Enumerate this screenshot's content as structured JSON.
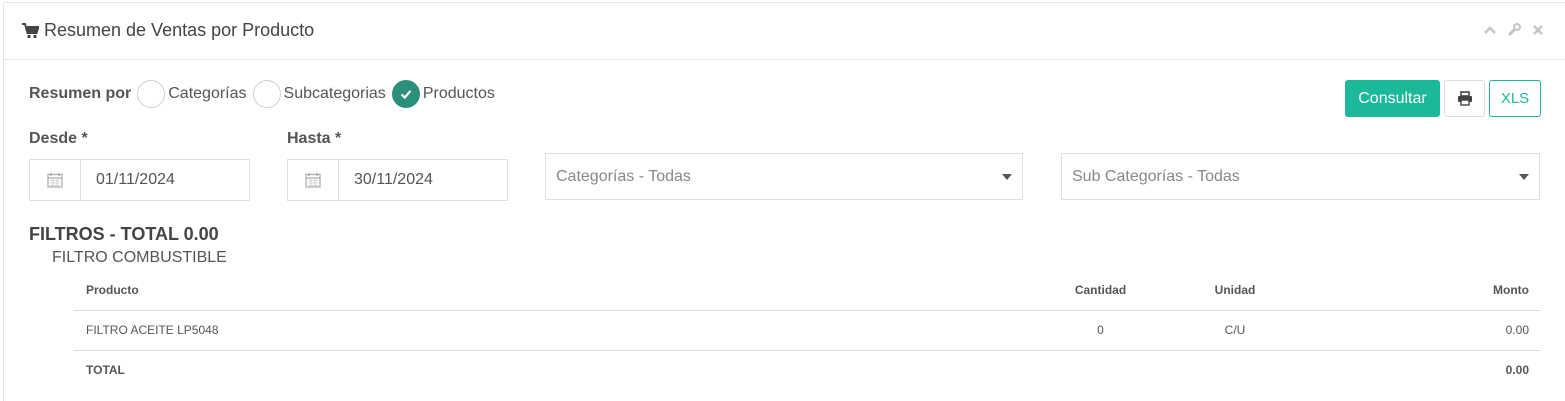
{
  "panel": {
    "title": "Resumen de Ventas por Producto",
    "icons": [
      "cart-icon",
      "chevron-up-icon",
      "wrench-icon",
      "close-icon"
    ]
  },
  "filters": {
    "resumen_por_label": "Resumen por",
    "options": [
      {
        "label": "Categorías",
        "checked": false
      },
      {
        "label": "Subcategorias",
        "checked": false
      },
      {
        "label": "Productos",
        "checked": true
      }
    ],
    "desde_label": "Desde *",
    "desde_value": "01/11/2024",
    "hasta_label": "Hasta *",
    "hasta_value": "30/11/2024",
    "categorias_selected": "Categorías - Todas",
    "subcategorias_selected": "Sub Categorías - Todas"
  },
  "actions": {
    "consultar_label": "Consultar",
    "xls_label": "XLS"
  },
  "results": {
    "section_title": "FILTROS - TOTAL 0.00",
    "subsection_title": "FILTRO COMBUSTIBLE",
    "columns": [
      "Producto",
      "Cantidad",
      "Unidad",
      "Monto"
    ],
    "rows": [
      {
        "producto": "FILTRO ACEITE LP5048",
        "cantidad": "0",
        "unidad": "C/U",
        "monto": "0.00"
      }
    ],
    "total_label": "TOTAL",
    "total_monto": "0.00"
  },
  "colors": {
    "accent": "#1bb99a",
    "check": "#2c8f7c"
  }
}
